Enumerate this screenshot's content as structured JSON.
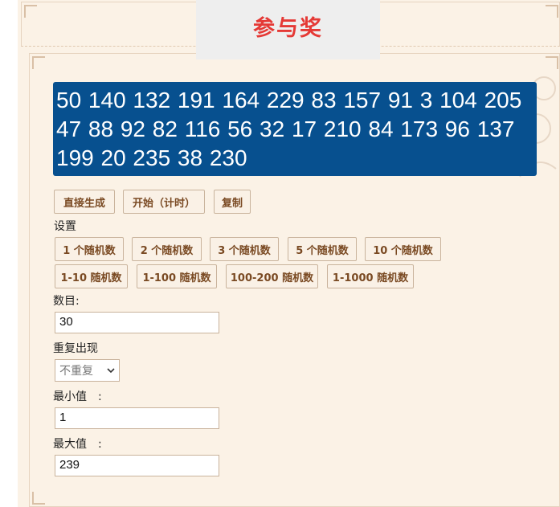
{
  "header": {
    "title": "参与奖"
  },
  "results": {
    "numbers": "50 140 132 191 164 229 83 157 91 3 104 205 47 88 92 82 116 56 32 17 210 84 173 96 137 199 20 235 38 230"
  },
  "actions": {
    "generate": "直接生成",
    "start_timed": "开始（计时）",
    "copy": "复制"
  },
  "settings": {
    "label": "设置",
    "presets_count": [
      "1 个随机数",
      "2 个随机数",
      "3 个随机数",
      "5 个随机数",
      "10 个随机数"
    ],
    "presets_range": [
      "1-10 随机数",
      "1-100 随机数",
      "100-200 随机数",
      "1-1000 随机数"
    ]
  },
  "form": {
    "count_label": "数目:",
    "count_value": "30",
    "repeat_label": "重复出现",
    "repeat_value": "不重复",
    "min_label": "最小值　:",
    "min_value": "1",
    "max_label": "最大值　:",
    "max_value": "239"
  },
  "colors": {
    "accent_title": "#e53935",
    "results_bg": "#07508f",
    "page_bg": "#fbf2e6"
  }
}
